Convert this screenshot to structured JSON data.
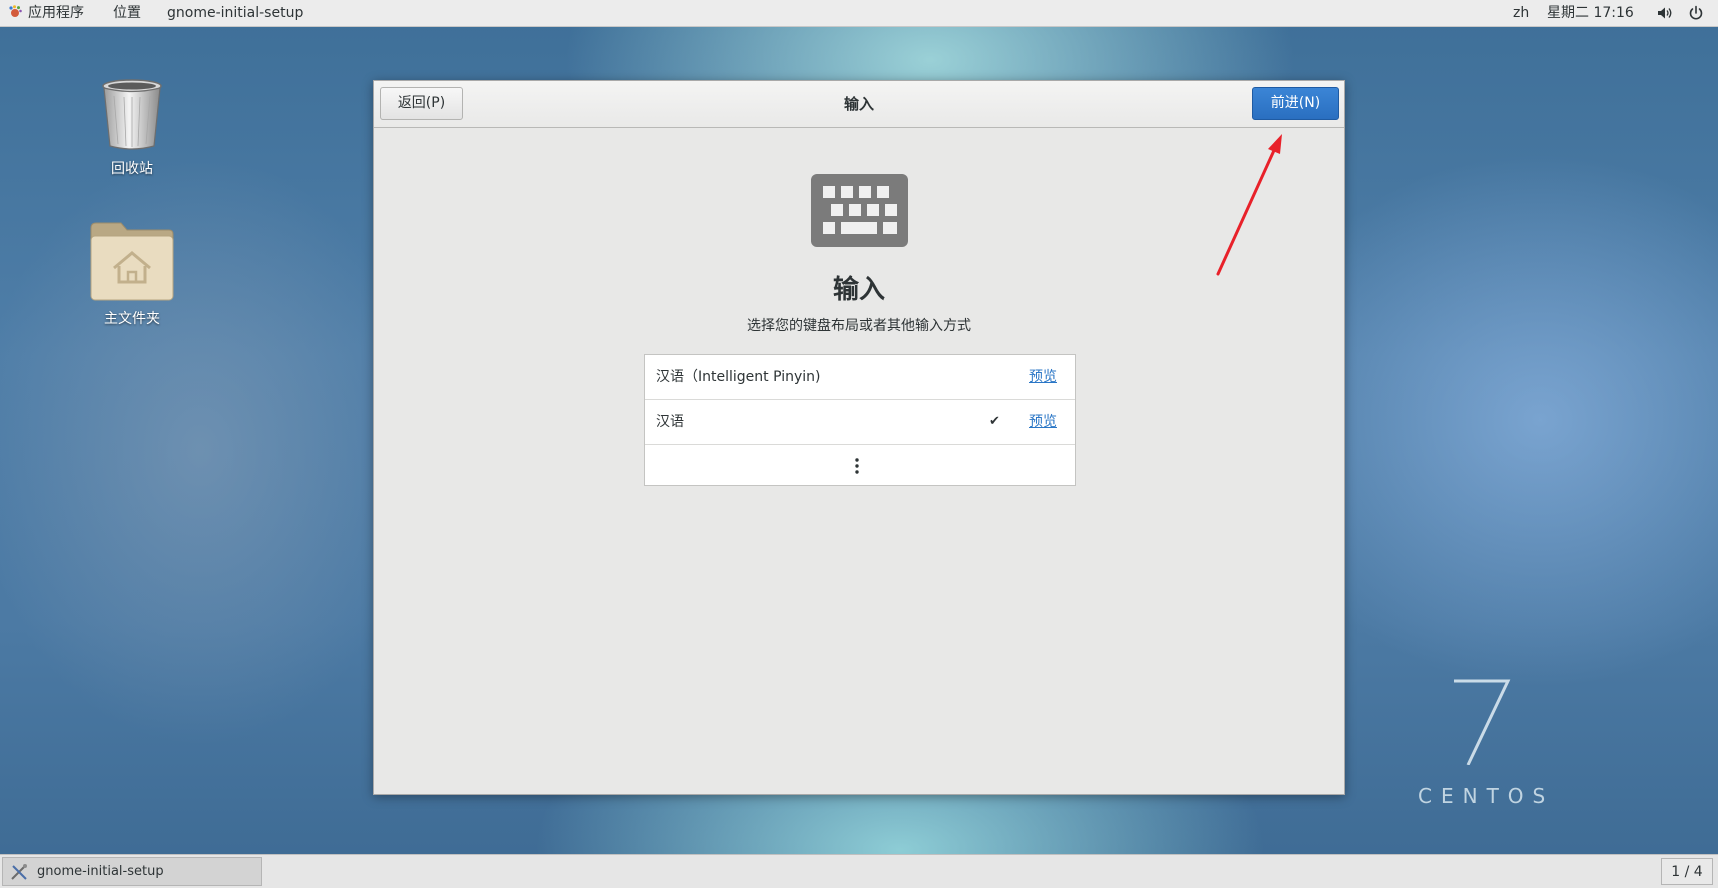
{
  "topbar": {
    "apps_label": "应用程序",
    "places_label": "位置",
    "app_name": "gnome-initial-setup",
    "language": "zh",
    "clock": "星期二 17:16"
  },
  "desktop": {
    "icons": [
      {
        "label": "回收站",
        "icon": "trash-icon"
      },
      {
        "label": "主文件夹",
        "icon": "home-folder-icon"
      }
    ],
    "watermark_number": "7",
    "watermark_text": "CENTOS"
  },
  "dialog": {
    "back_label": "返回(P)",
    "next_label": "前进(N)",
    "title": "输入",
    "heading": "输入",
    "subtitle": "选择您的键盘布局或者其他输入方式",
    "sources": [
      {
        "name": "汉语（Intelligent Pinyin)",
        "selected": false,
        "preview_label": "预览"
      },
      {
        "name": "汉语",
        "selected": true,
        "preview_label": "预览"
      }
    ],
    "icon": "keyboard-icon",
    "accent_color": "#2a76c6"
  },
  "annotation": {
    "color": "#e8212a",
    "icon": "red-arrow"
  },
  "taskbar": {
    "task_label": "gnome-initial-setup",
    "workspace": "1 / 4"
  }
}
